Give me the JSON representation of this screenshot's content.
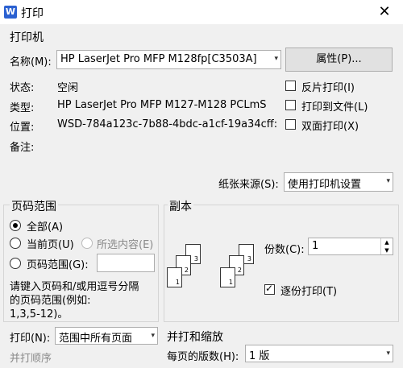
{
  "window": {
    "title": "打印",
    "app_icon_letter": "W",
    "close": "✕"
  },
  "printer": {
    "group_title": "打印机",
    "name_label": "名称(M):",
    "name_value": "HP LaserJet Pro MFP M128fp[C3503A]",
    "properties_button": "属性(P)...",
    "status_label": "状态:",
    "status_value": "空闲",
    "type_label": "类型:",
    "type_value": "HP LaserJet Pro MFP M127-M128 PCLmS",
    "location_label": "位置:",
    "location_value": "WSD-784a123c-7b88-4bdc-a1cf-19a34cff:",
    "comment_label": "备注:",
    "reverse_print": "反片打印(I)",
    "print_to_file": "打印到文件(L)",
    "duplex_print": "双面打印(X)",
    "paper_source_label": "纸张来源(S):",
    "paper_source_value": "使用打印机设置"
  },
  "page_range": {
    "group_title": "页码范围",
    "all": "全部(A)",
    "current": "当前页(U)",
    "selection": "所选内容(E)",
    "pages": "页码范围(G):",
    "pages_value": "",
    "hint": [
      "请键入页码和/或用逗号分隔",
      "的页码范围(例如:",
      "1,3,5-12)。"
    ],
    "print_label": "打印(N):",
    "print_value": "范围中所有页面",
    "collate_group": "并打顺序"
  },
  "copies": {
    "group_title": "副本",
    "count_label": "份数(C):",
    "count_value": "1",
    "collate": "逐份打印(T)",
    "page_numbers": [
      "1",
      "2",
      "3"
    ]
  },
  "zoom": {
    "group_title": "并打和缩放",
    "pages_per_sheet_label": "每页的版数(H):",
    "pages_per_sheet_value": "1 版"
  },
  "icons": {
    "dropdown": "▾",
    "spin_up": "▲",
    "spin_down": "▼"
  }
}
